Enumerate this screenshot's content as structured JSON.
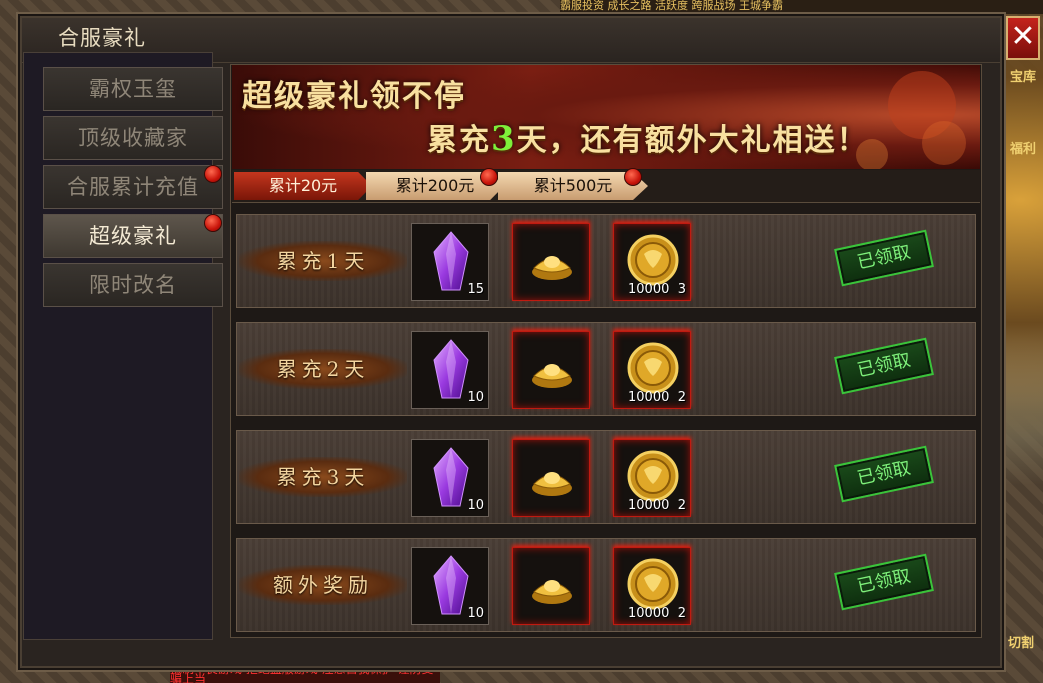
{
  "background": {
    "top_text": "霸服投资  成长之路  活跃度  跨服战场  王城争霸",
    "bottom_text": "抵制不良游戏 拒绝盗版游戏 注意自我保护 谨防受骗上当",
    "right_labels": [
      "宝库",
      "福利",
      "切割"
    ]
  },
  "dialog": {
    "title": "合服豪礼",
    "close_label": "✕"
  },
  "sidebar": {
    "items": [
      {
        "label": "霸权玉玺",
        "active": false,
        "dot": false
      },
      {
        "label": "顶级收藏家",
        "active": false,
        "dot": false
      },
      {
        "label": "合服累计充值",
        "active": false,
        "dot": true
      },
      {
        "label": "超级豪礼",
        "active": true,
        "dot": true
      },
      {
        "label": "限时改名",
        "active": false,
        "dot": false
      }
    ]
  },
  "banner": {
    "line1": "超级豪礼领不停",
    "line2_prefix": "累充",
    "line2_highlight": "3",
    "line2_suffix": "天，还有额外大礼相送！"
  },
  "tabs": [
    {
      "label": "累计20元",
      "active": true,
      "dot": false
    },
    {
      "label": "累计200元",
      "active": false,
      "dot": true
    },
    {
      "label": "累计500元",
      "active": false,
      "dot": true
    }
  ],
  "rows": [
    {
      "label": "累充1天",
      "crystal_count": "15",
      "coin_amount": "10000",
      "coin_count": "3",
      "status": "已领取"
    },
    {
      "label": "累充2天",
      "crystal_count": "10",
      "coin_amount": "10000",
      "coin_count": "2",
      "status": "已领取"
    },
    {
      "label": "累充3天",
      "crystal_count": "10",
      "coin_amount": "10000",
      "coin_count": "2",
      "status": "已领取"
    },
    {
      "label": "额外奖励",
      "crystal_count": "10",
      "coin_amount": "10000",
      "coin_count": "2",
      "status": "已领取"
    }
  ],
  "colors": {
    "accent_red": "#c01a10",
    "claimed_green": "#3ac43a",
    "gold": "#f8e0a0",
    "highlight_green": "#7ef03a"
  },
  "icons": {
    "crystal": "purple-crystal-icon",
    "ingot": "gold-ingot-icon",
    "coin": "gold-coin-icon"
  }
}
